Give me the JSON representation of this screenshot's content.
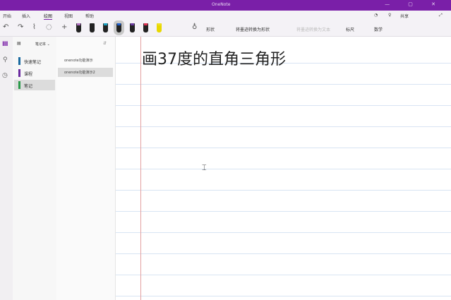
{
  "app": {
    "title": "OneNote",
    "window_controls": "— ▢ ✕"
  },
  "tabs": [
    {
      "label": "开始"
    },
    {
      "label": "插入"
    },
    {
      "label": "绘图"
    },
    {
      "label": "视图"
    },
    {
      "label": "帮助"
    }
  ],
  "top_right": {
    "share": "共享"
  },
  "toolbar": {
    "undo": "↶",
    "redo": "↷",
    "lasso": "⌇",
    "eraser": "◌",
    "add": "+",
    "convert_shape": "将墨迹转换为形状",
    "convert_text": "将墨迹转换为文本",
    "ruler": "标尺",
    "math": "数学",
    "shapes": "形状"
  },
  "pens": [
    "#b070c0",
    "#222222",
    "#1aa0c0",
    "#2060d0",
    "#6a3aa0",
    "#e03050",
    "#f0e020"
  ],
  "notebook": {
    "name": "笔记本 ⌄",
    "sections": [
      {
        "label": "快速笔记",
        "color": "#1a6aa0"
      },
      {
        "label": "课程",
        "color": "#6a2aa0"
      },
      {
        "label": "笔记",
        "color": "#2a9a4a"
      }
    ],
    "pages": [
      {
        "label": "onenote功能演示"
      },
      {
        "label": "onenote功能演示2"
      }
    ]
  },
  "page": {
    "title": "画37度的直角三角形"
  }
}
